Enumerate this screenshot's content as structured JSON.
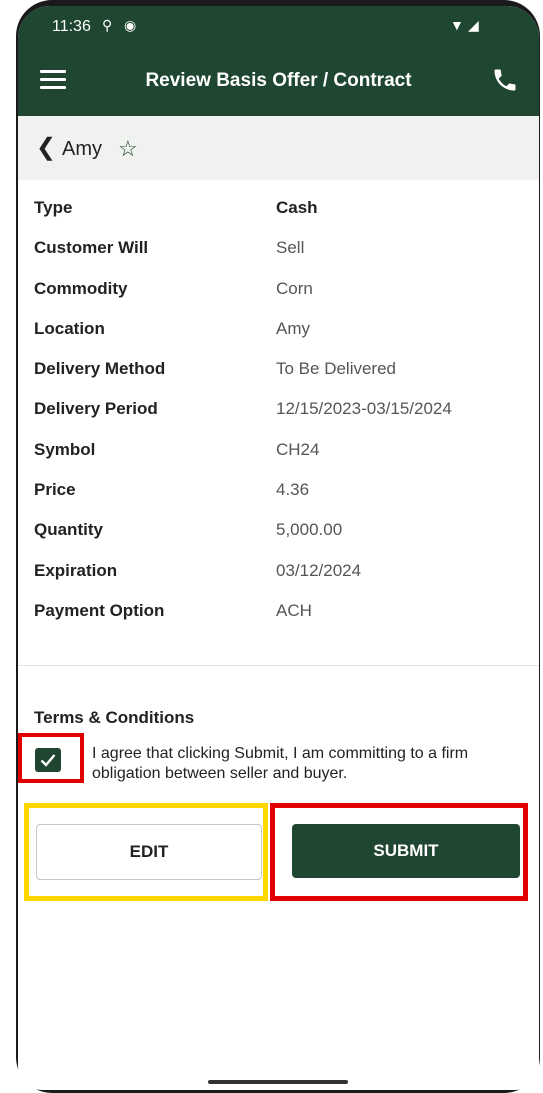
{
  "status_bar": {
    "time": "11:36",
    "notification_icons": [
      "usb-icon",
      "sync-icon"
    ],
    "right_icons": [
      "wifi-icon",
      "signal-icon"
    ]
  },
  "app_bar": {
    "title": "Review Basis Offer / Contract",
    "menu_icon": "menu-icon",
    "call_icon": "phone-icon",
    "background_color": "#1e4631"
  },
  "subheader": {
    "back_icon": "chevron-left-icon",
    "title": "Amy",
    "favorite_icon": "star-outline-icon"
  },
  "details": [
    {
      "label": "Type",
      "value": "Cash"
    },
    {
      "label": "Customer Will",
      "value": "Sell"
    },
    {
      "label": "Commodity",
      "value": "Corn"
    },
    {
      "label": "Location",
      "value": "Amy"
    },
    {
      "label": "Delivery Method",
      "value": "To Be Delivered"
    },
    {
      "label": "Delivery Period",
      "value": "12/15/2023-03/15/2024"
    },
    {
      "label": "Symbol",
      "value": "CH24"
    },
    {
      "label": "Price",
      "value": "4.36"
    },
    {
      "label": "Quantity",
      "value": "5,000.00"
    },
    {
      "label": "Expiration",
      "value": "03/12/2024"
    },
    {
      "label": "Payment Option",
      "value": "ACH"
    }
  ],
  "terms": {
    "title": "Terms & Conditions",
    "agree_text": "I agree that clicking Submit, I am committing to a firm obligation between seller and buyer.",
    "checked": true
  },
  "actions": {
    "edit_label": "EDIT",
    "submit_label": "SUBMIT"
  },
  "colors": {
    "primary": "#1e4631",
    "highlight_red": "#e00000",
    "highlight_yellow": "#ffd800"
  }
}
